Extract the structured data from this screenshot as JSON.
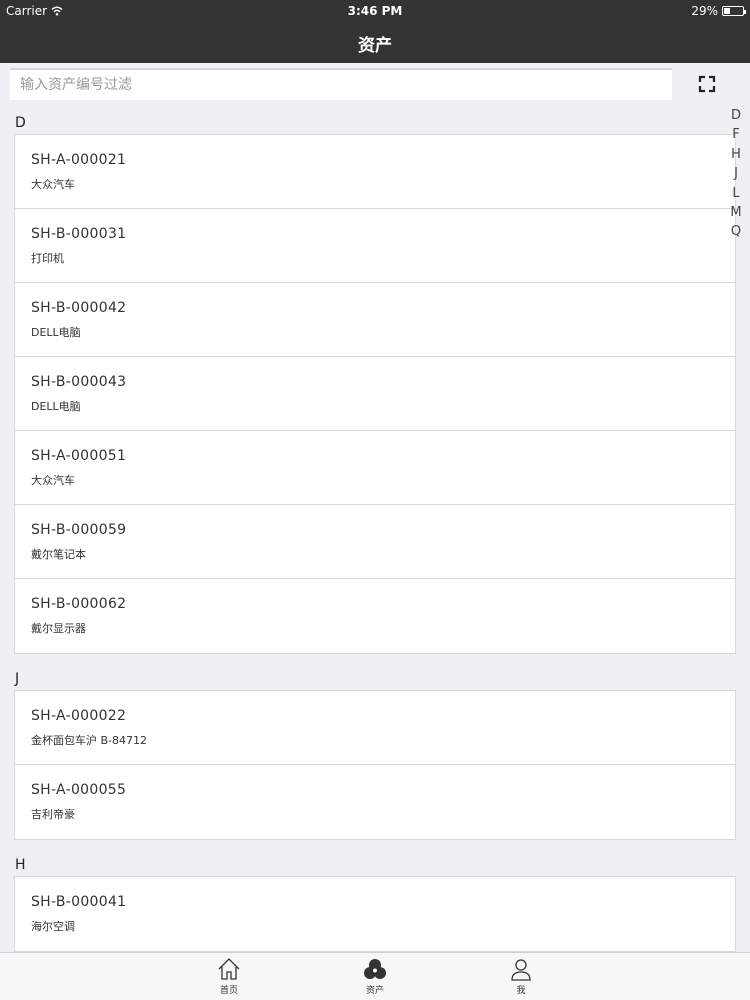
{
  "status_bar": {
    "carrier": "Carrier",
    "time": "3:46 PM",
    "battery": "29%",
    "battery_level": 0.29
  },
  "nav": {
    "title": "资产"
  },
  "search": {
    "placeholder": "输入资产编号过滤",
    "value": ""
  },
  "index_letters": [
    "D",
    "F",
    "H",
    "J",
    "L",
    "M",
    "Q"
  ],
  "sections": [
    {
      "letter": "D",
      "items": [
        {
          "code": "SH-A-000021",
          "name": "大众汽车"
        },
        {
          "code": "SH-B-000031",
          "name": "打印机"
        },
        {
          "code": "SH-B-000042",
          "name": "DELL电脑"
        },
        {
          "code": "SH-B-000043",
          "name": "DELL电脑"
        },
        {
          "code": "SH-A-000051",
          "name": "大众汽车"
        },
        {
          "code": "SH-B-000059",
          "name": "戴尔笔记本"
        },
        {
          "code": "SH-B-000062",
          "name": "戴尔显示器"
        }
      ]
    },
    {
      "letter": "J",
      "items": [
        {
          "code": "SH-A-000022",
          "name": "金杯面包车沪 B-84712"
        },
        {
          "code": "SH-A-000055",
          "name": "吉利帝豪"
        }
      ]
    },
    {
      "letter": "H",
      "items": [
        {
          "code": "SH-B-000041",
          "name": "海尔空调"
        }
      ]
    }
  ],
  "tabs": [
    {
      "label": "首页",
      "icon": "home-icon"
    },
    {
      "label": "资产",
      "icon": "assets-icon"
    },
    {
      "label": "我",
      "icon": "person-icon"
    }
  ]
}
